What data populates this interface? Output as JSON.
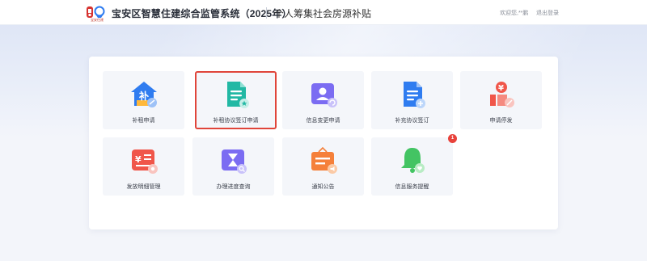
{
  "header": {
    "logo_caption": "宝安住建",
    "site_title": "宝安区智慧住建综合监管系统（2025年）",
    "sub_title": "个人筹集社会房源补贴",
    "welcome": "欢迎您,**鹏",
    "logout": "退出登录"
  },
  "tiles": [
    {
      "label": "补租申请",
      "icon": "house-coin-icon"
    },
    {
      "label": "补租协议签订申请",
      "icon": "document-star-icon",
      "selected": true
    },
    {
      "label": "信息变更申请",
      "icon": "user-refresh-icon"
    },
    {
      "label": "补充协议签订",
      "icon": "document-plus-icon"
    },
    {
      "label": "申请停发",
      "icon": "money-stop-icon"
    },
    {
      "label": "发放明细管理",
      "icon": "money-list-icon"
    },
    {
      "label": "办理进度查询",
      "icon": "hourglass-search-icon"
    },
    {
      "label": "通知公告",
      "icon": "notice-board-icon"
    },
    {
      "label": "信息服务提醒",
      "icon": "bell-heart-icon"
    }
  ],
  "badge": {
    "count": "1"
  },
  "colors": {
    "selected_border": "#e0453a",
    "tile_bg": "#f4f6fa",
    "blue": "#2f7cf0",
    "teal": "#22b8a4",
    "purple": "#7b6cf2",
    "red": "#f0564a",
    "orange": "#f5803a",
    "green": "#43c463"
  }
}
